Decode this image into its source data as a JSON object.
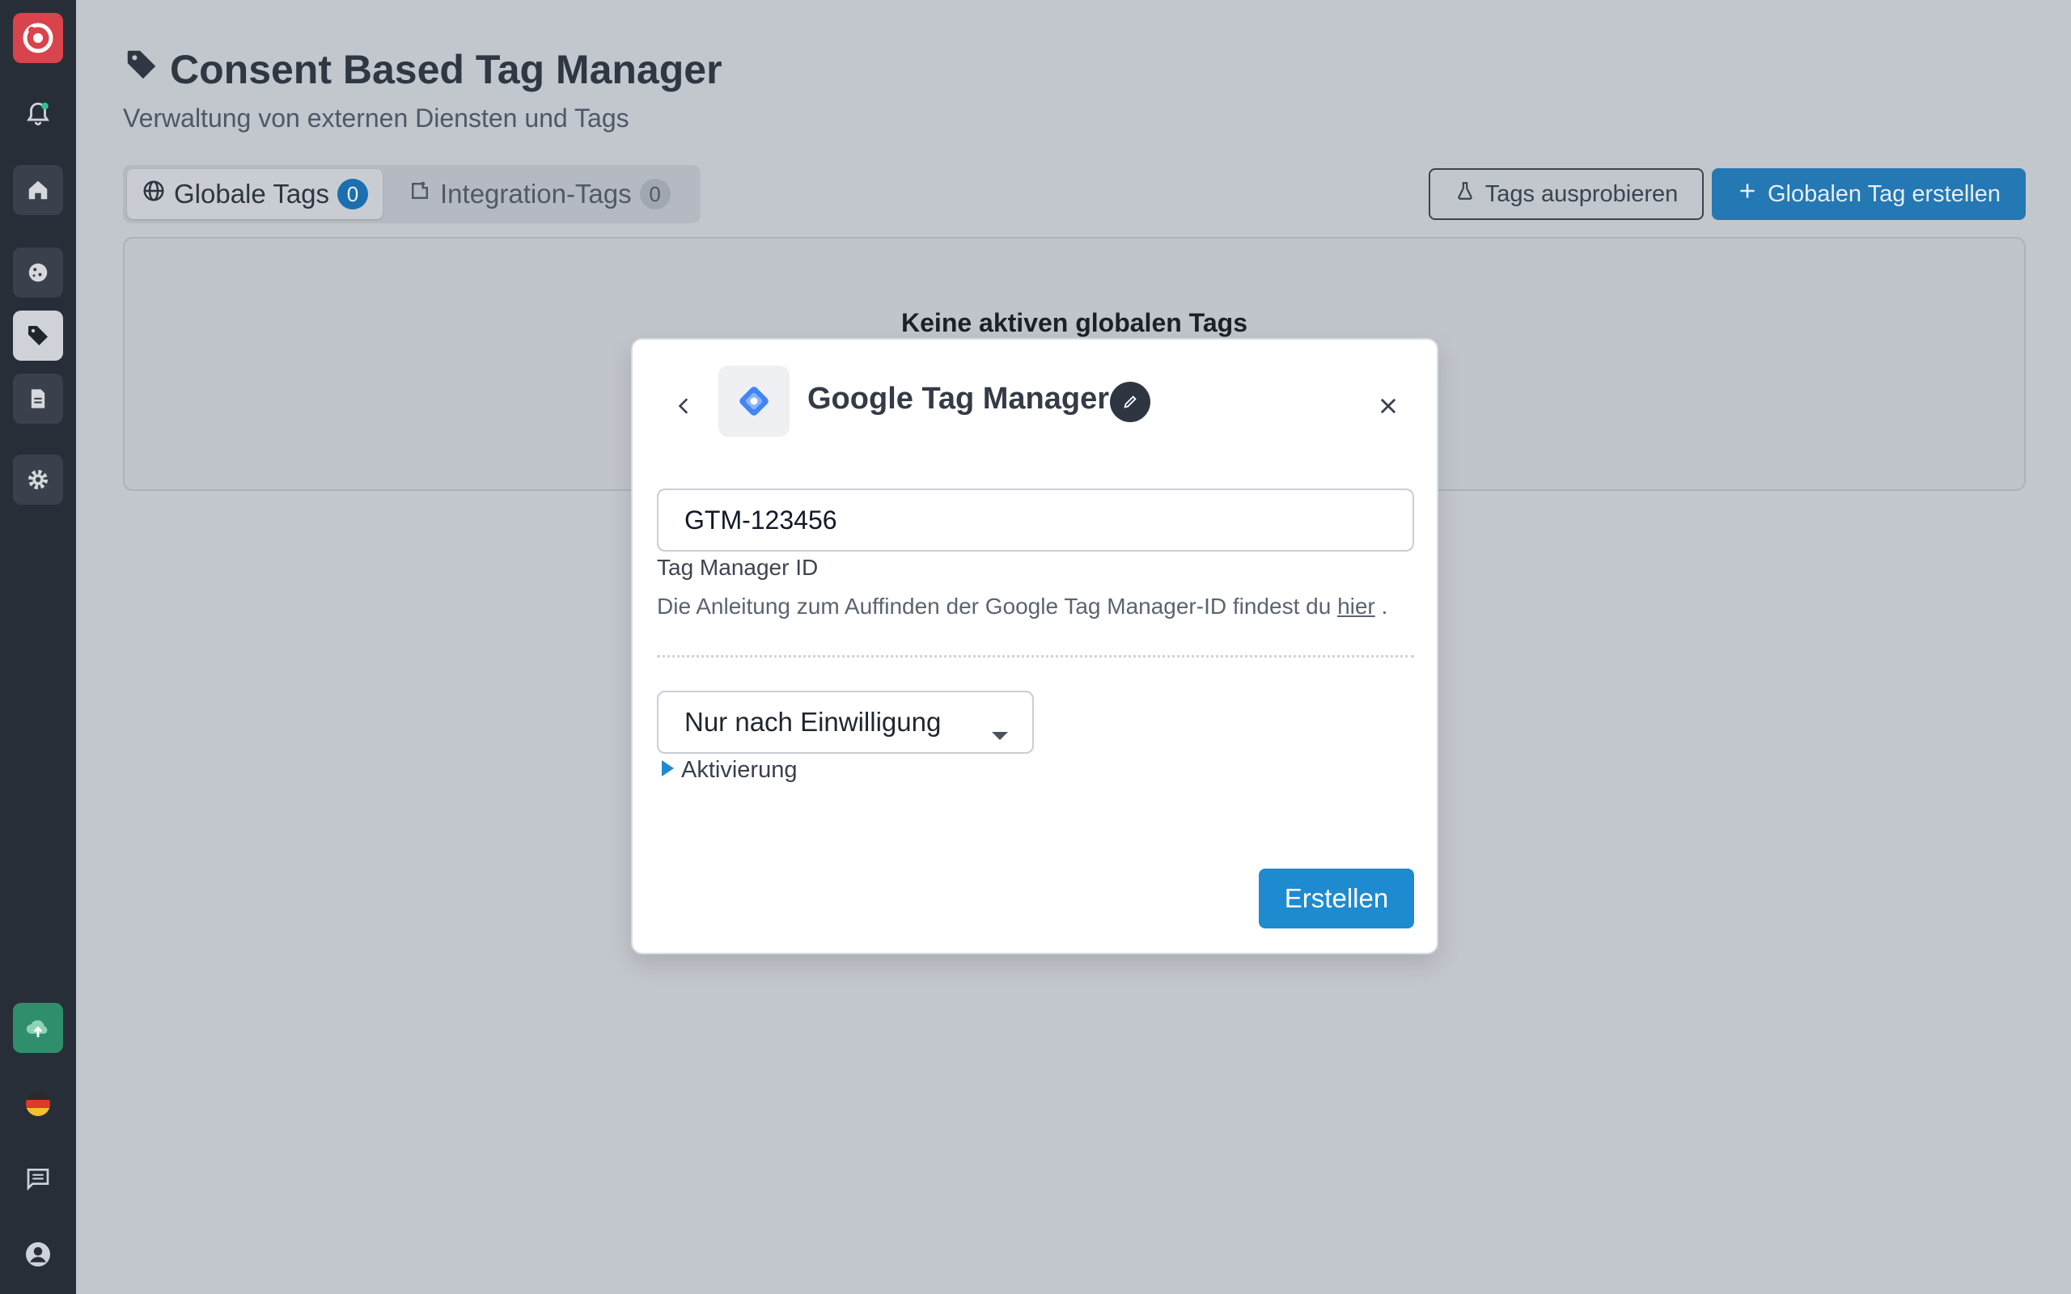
{
  "page": {
    "title": "Consent Based Tag Manager",
    "subtitle": "Verwaltung von externen Diensten und Tags"
  },
  "tabs": [
    {
      "label": "Globale Tags",
      "count": "0",
      "icon": "globe-icon",
      "active": true
    },
    {
      "label": "Integration-Tags",
      "count": "0",
      "icon": "integration-icon",
      "active": false
    }
  ],
  "actions": {
    "try_label": "Tags ausprobieren",
    "create_global_label": "Globalen Tag erstellen"
  },
  "empty_state": {
    "title": "Keine aktiven globalen Tags"
  },
  "modal": {
    "title": "Google Tag Manager",
    "id_value": "GTM-123456",
    "id_label": "Tag Manager ID",
    "help_text": "Die Anleitung zum Auffinden der Google Tag Manager-ID findest du",
    "help_link": "hier",
    "help_suffix": " .",
    "consent_select": "Nur nach Einwilligung",
    "activation_label": "Aktivierung",
    "submit_label": "Erstellen"
  },
  "sidebar": {
    "items": [
      "logo",
      "notifications",
      "home",
      "cookie",
      "tags",
      "document",
      "settings",
      "upload",
      "language-de",
      "chat",
      "account"
    ],
    "active": "tags"
  },
  "colors": {
    "primary": "#1e8ad0",
    "sidebar": "#282e38",
    "overlay_bg": "#c2c6cd"
  }
}
